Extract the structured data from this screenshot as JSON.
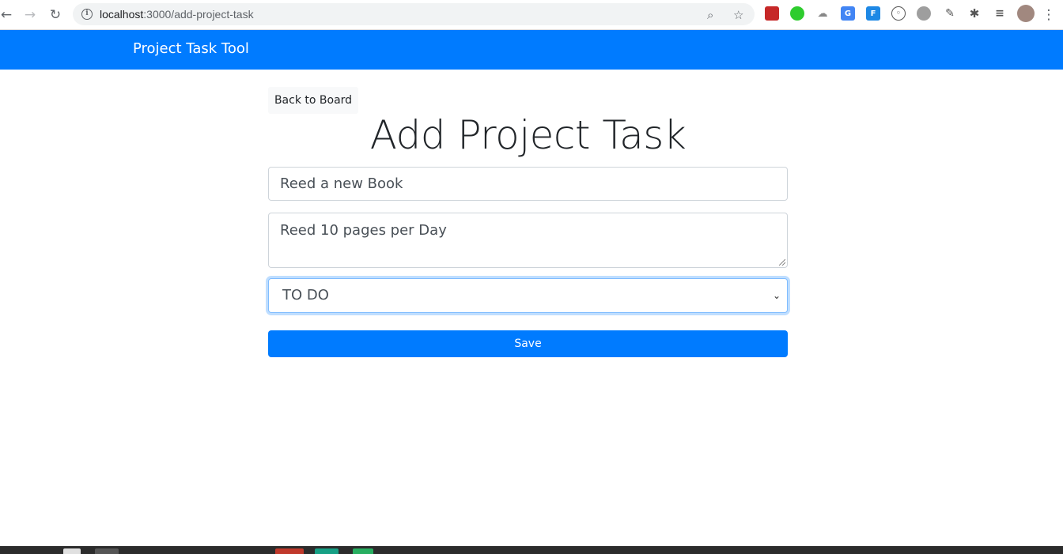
{
  "browser": {
    "url_host": "localhost",
    "url_path": ":3000/add-project-task",
    "back_glyph": "←",
    "forward_glyph": "→",
    "reload_glyph": "↻",
    "zoom_glyph": "⌕",
    "star_glyph": "☆",
    "menu_glyph": "⋮",
    "extensions": [
      {
        "icon": "puzzle-icon"
      }
    ]
  },
  "navbar": {
    "brand": "Project Task Tool",
    "color": "#007bff"
  },
  "form": {
    "back_label": "Back to Board",
    "title": "Add Project Task",
    "summary_value": "Reed a new Book",
    "description_value": "Reed 10 pages per Day",
    "status_selected": "TO DO",
    "save_label": "Save"
  }
}
